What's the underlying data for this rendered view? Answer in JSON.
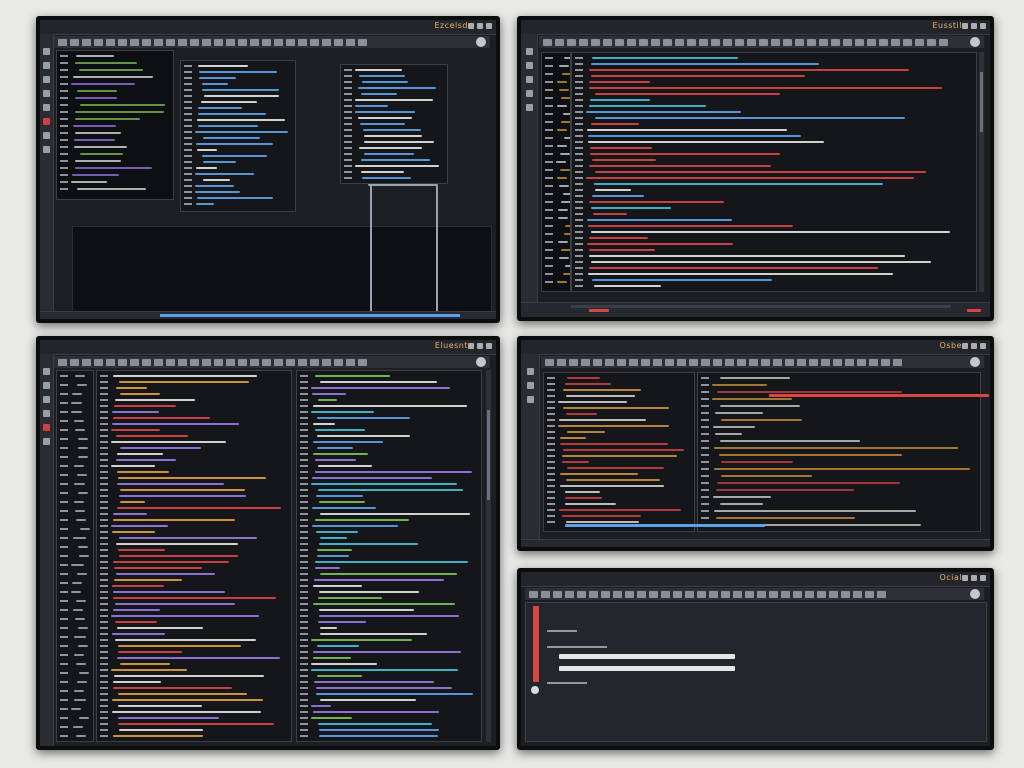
{
  "monitors": [
    {
      "id": "top-left",
      "title_text": "Ezcelsd"
    },
    {
      "id": "top-right",
      "title_text": "Eusstil"
    },
    {
      "id": "middle-left",
      "title_text": "Eluesnt"
    },
    {
      "id": "middle-right",
      "title_text": "Osbe"
    },
    {
      "id": "bottom-right",
      "title_text": "Ocial"
    }
  ],
  "colors": {
    "blue": "#5da2e8",
    "red": "#d94646",
    "purple": "#9a7be6",
    "green": "#7fc25a",
    "orange": "#e0a040",
    "cyan": "#48c0d8",
    "white": "#e6e6e6"
  },
  "icons": [
    "minimize-icon",
    "maximize-icon",
    "close-icon",
    "menu-icon",
    "folder-icon"
  ]
}
